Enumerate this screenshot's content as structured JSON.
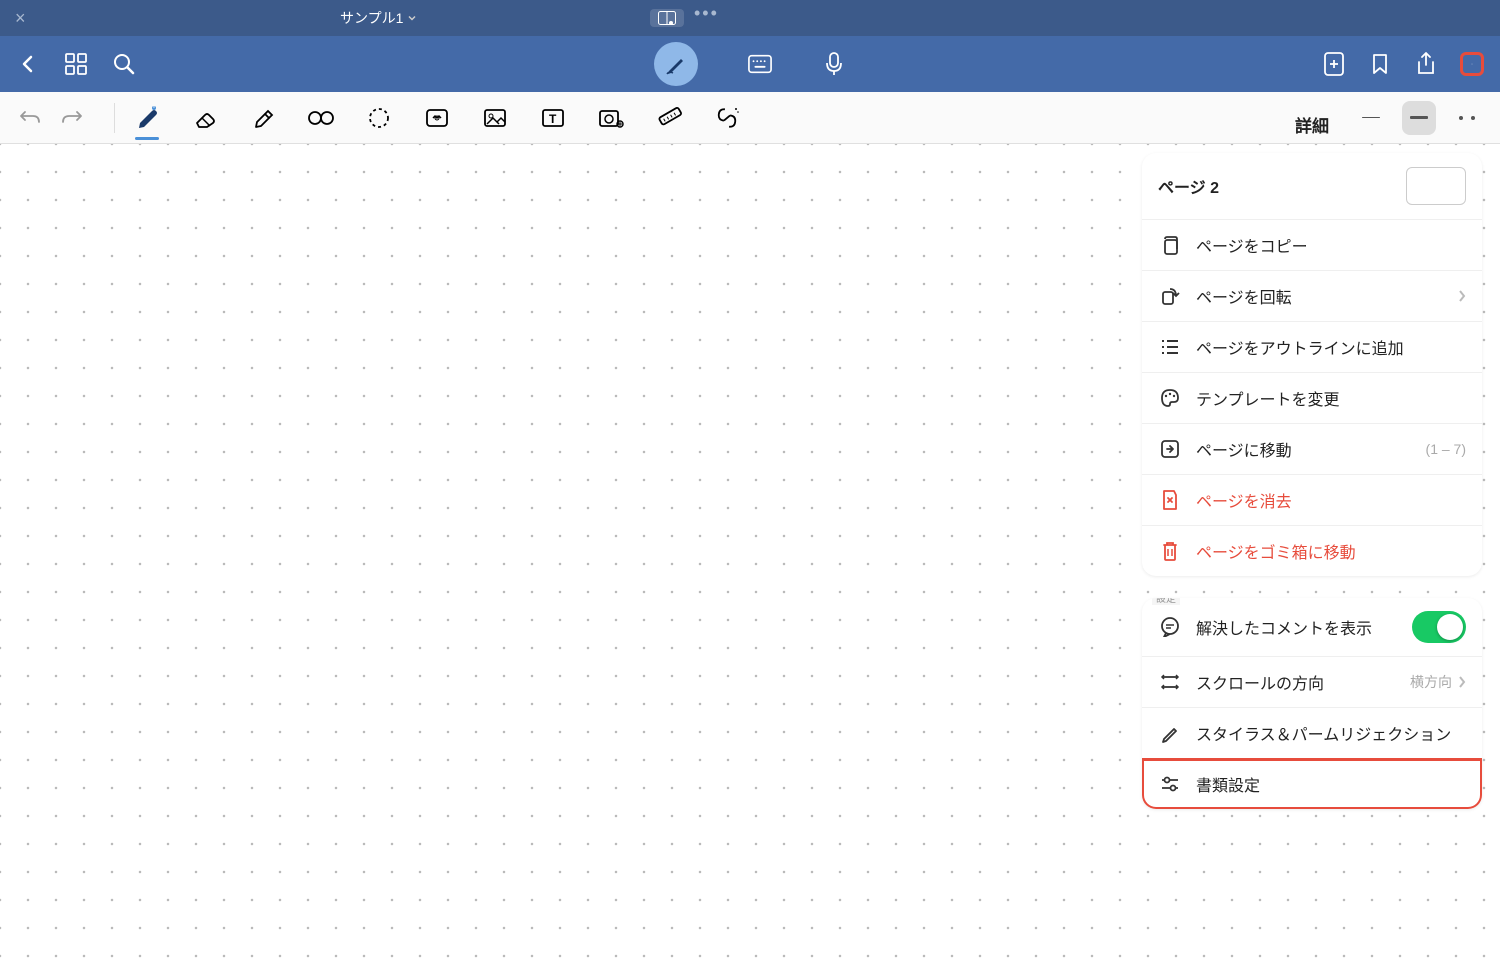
{
  "header": {
    "document_title": "サンプル1",
    "close": "×"
  },
  "popover": {
    "title": "詳細",
    "page_label": "ページ 2",
    "actions": {
      "copy": "ページをコピー",
      "rotate": "ページを回転",
      "outline": "ページをアウトラインに追加",
      "template": "テンプレートを変更",
      "goto": "ページに移動",
      "goto_range": "(1 – 7)",
      "clear": "ページを消去",
      "trash": "ページをゴミ箱に移動"
    },
    "settings": {
      "section_hint": "設定",
      "resolved_comments": "解決したコメントを表示",
      "scroll_direction": "スクロールの方向",
      "scroll_value": "横方向",
      "stylus": "スタイラス＆パームリジェクション",
      "document_settings": "書類設定"
    }
  }
}
